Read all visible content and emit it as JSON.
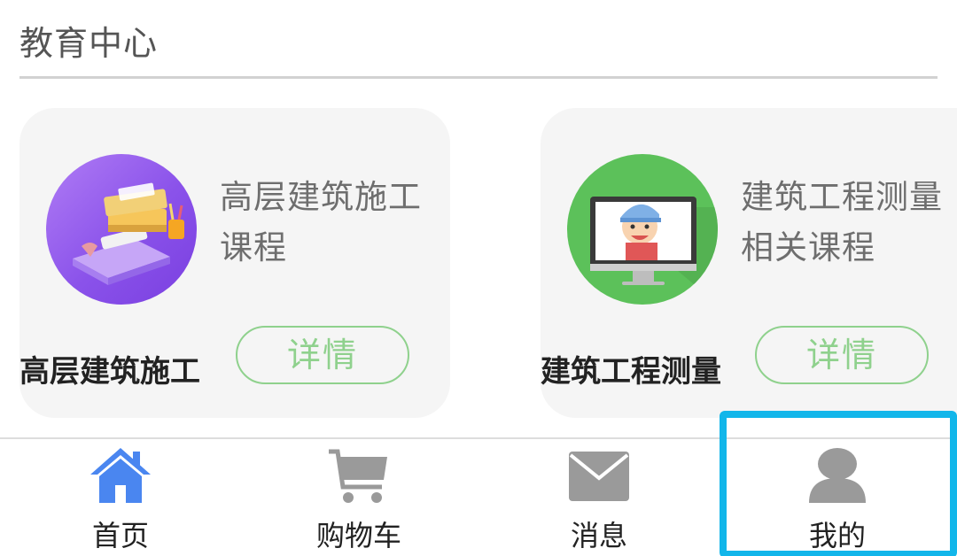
{
  "section": {
    "title": "教育中心"
  },
  "courses": [
    {
      "description": "高层建筑施工课程",
      "name": "高层建筑施工",
      "detail_label": "详情",
      "image_icon": "books-diploma-icon"
    },
    {
      "description": "建筑工程测量相关课程",
      "name": "建筑工程测量",
      "detail_label": "详情",
      "image_icon": "monitor-worker-icon"
    }
  ],
  "tabbar": {
    "items": [
      {
        "label": "首页",
        "icon": "home-icon",
        "active": true
      },
      {
        "label": "购物车",
        "icon": "cart-icon",
        "active": false
      },
      {
        "label": "消息",
        "icon": "mail-icon",
        "active": false
      },
      {
        "label": "我的",
        "icon": "user-icon",
        "active": false
      }
    ]
  },
  "colors": {
    "accent_green": "#8fd18d",
    "active_blue": "#4a86f0",
    "inactive_gray": "#9a9a9a",
    "highlight_cyan": "#12b6ea"
  }
}
